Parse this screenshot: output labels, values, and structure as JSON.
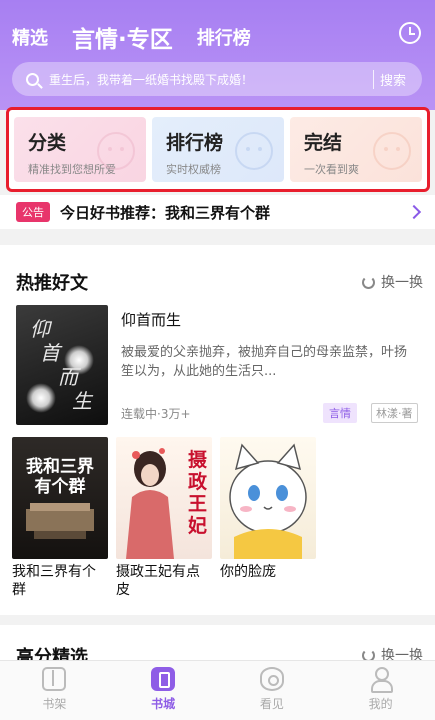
{
  "header": {
    "tabs": [
      {
        "label": "精选"
      },
      {
        "label": "言情·专区"
      },
      {
        "label": "排行榜"
      }
    ]
  },
  "search": {
    "placeholder": "重生后，我带着一纸婚书找殿下成婚！",
    "button": "搜索"
  },
  "categories": [
    {
      "title": "分类",
      "subtitle": "精准找到您想所爱"
    },
    {
      "title": "排行榜",
      "subtitle": "实时权威榜"
    },
    {
      "title": "完结",
      "subtitle": "一次看到爽"
    }
  ],
  "notice": {
    "badge": "公告",
    "text": "今日好书推荐：我和三界有个群"
  },
  "hot": {
    "title": "热推好文",
    "refresh": "换一换",
    "feature": {
      "title": "仰首而生",
      "cover_text": [
        "仰",
        "首",
        "而",
        "生"
      ],
      "description": "被最爱的父亲抛弃，被抛弃自己的母亲监禁，叶扬笙以为，从此她的生活只...",
      "meta": "连载中·3万+",
      "genre": "言情",
      "author": "林漾·著"
    },
    "books": [
      {
        "name": "我和三界有个群",
        "cover_text": "我和三界有个群"
      },
      {
        "name": "摄政王妃有点皮",
        "cover_text": "摄政王妃"
      },
      {
        "name": "你的脸庞",
        "cover_text": ""
      }
    ]
  },
  "high": {
    "title": "高分精选",
    "refresh": "换一换"
  },
  "nav": [
    {
      "label": "书架",
      "icon": "bookshelf-icon"
    },
    {
      "label": "书城",
      "icon": "bookstore-icon"
    },
    {
      "label": "看见",
      "icon": "eye-icon"
    },
    {
      "label": "我的",
      "icon": "user-icon"
    }
  ],
  "colors": {
    "accent": "#8e5de6",
    "header": "#a77ff2",
    "highlight_border": "#e81e2d",
    "notice_badge": "#e8356b"
  }
}
